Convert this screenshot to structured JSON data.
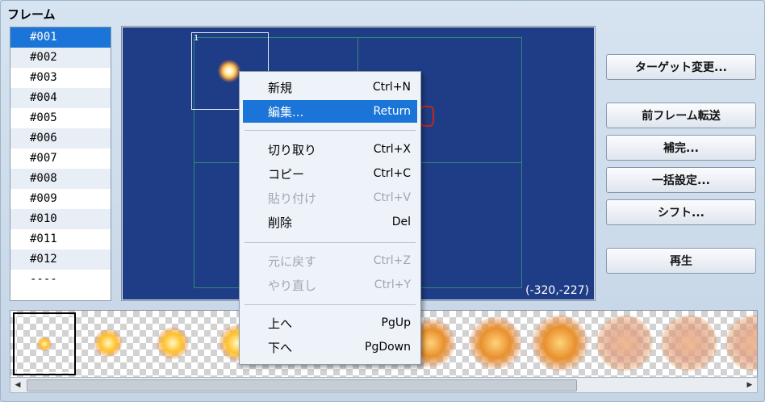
{
  "title": "フレーム",
  "frames": [
    "#001",
    "#002",
    "#003",
    "#004",
    "#005",
    "#006",
    "#007",
    "#008",
    "#009",
    "#010",
    "#011",
    "#012",
    "----"
  ],
  "selected_frame": 0,
  "canvas": {
    "cell_label": "1",
    "coords": "(-320,-227)"
  },
  "buttons": {
    "target": "ターゲット変更...",
    "prev_frame": "前フレーム転送",
    "interpolate": "補完...",
    "batch": "一括設定...",
    "shift": "シフト...",
    "play": "再生"
  },
  "menu": {
    "new": {
      "label": "新規",
      "shortcut": "Ctrl+N"
    },
    "edit": {
      "label": "編集...",
      "shortcut": "Return"
    },
    "cut": {
      "label": "切り取り",
      "shortcut": "Ctrl+X"
    },
    "copy": {
      "label": "コピー",
      "shortcut": "Ctrl+C"
    },
    "paste": {
      "label": "貼り付け",
      "shortcut": "Ctrl+V"
    },
    "delete": {
      "label": "削除",
      "shortcut": "Del"
    },
    "undo": {
      "label": "元に戻す",
      "shortcut": "Ctrl+Z"
    },
    "redo": {
      "label": "やり直し",
      "shortcut": "Ctrl+Y"
    },
    "up": {
      "label": "上へ",
      "shortcut": "PgUp"
    },
    "down": {
      "label": "下へ",
      "shortcut": "PgDown"
    }
  },
  "scrollbar": {
    "left_arrow": "◀",
    "right_arrow": "▶"
  },
  "colors": {
    "selection": "#1b74d8",
    "canvas": "#1f3d86",
    "grid": "#2e8a73"
  }
}
